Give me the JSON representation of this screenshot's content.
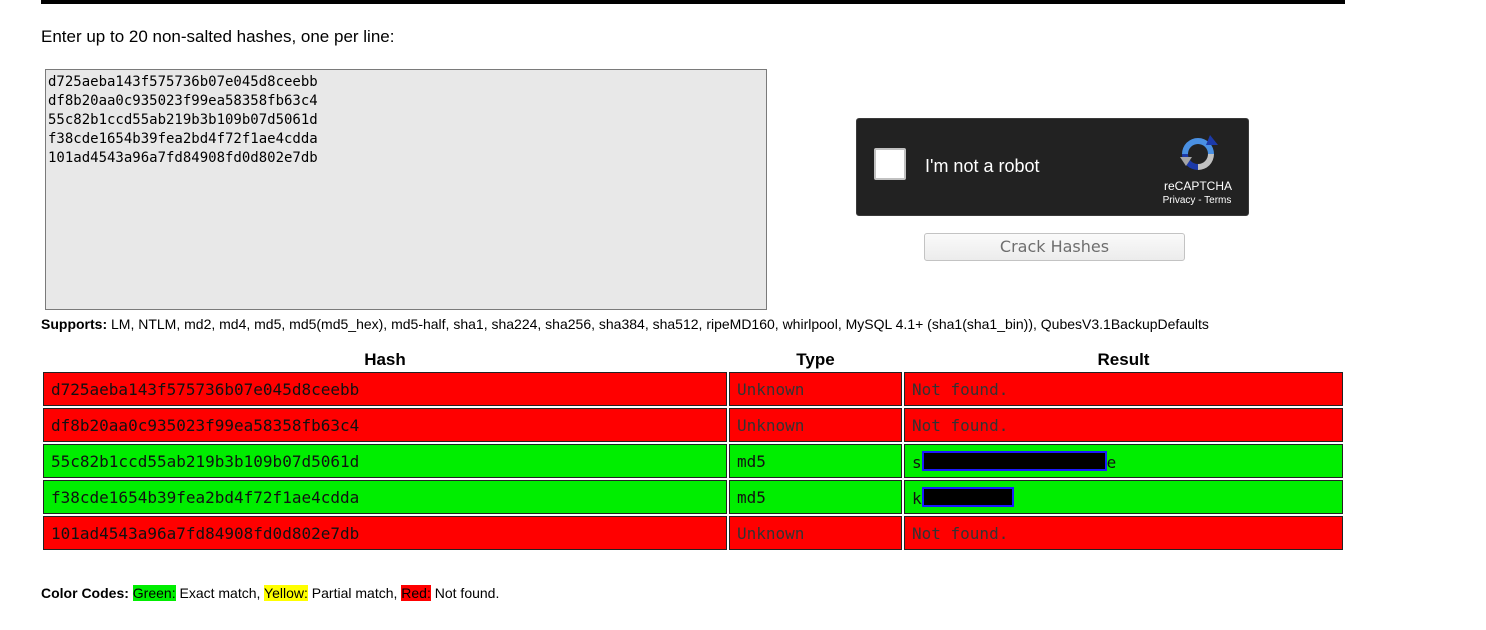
{
  "form": {
    "prompt": "Enter up to 20 non-salted hashes, one per line:",
    "hash_input_value": "d725aeba143f575736b07e045d8ceebb\ndf8b20aa0c935023f99ea58358fb63c4\n55c82b1ccd55ab219b3b109b07d5061d\nf38cde1654b39fea2bd4f72f1ae4cdda\n101ad4543a96a7fd84908fd0d802e7db",
    "crack_button_label": "Crack Hashes"
  },
  "recaptcha": {
    "checkbox_label": "I'm not a robot",
    "brand": "reCAPTCHA",
    "privacy_label": "Privacy",
    "separator": " - ",
    "terms_label": "Terms",
    "logo_icon": "recaptcha-logo-icon"
  },
  "supports": {
    "label": "Supports:",
    "text": " LM, NTLM, md2, md4, md5, md5(md5_hex), md5-half, sha1, sha224, sha256, sha384, sha512, ripeMD160, whirlpool, MySQL 4.1+ (sha1(sha1_bin)), QubesV3.1BackupDefaults"
  },
  "results_table": {
    "headers": {
      "hash": "Hash",
      "type": "Type",
      "result": "Result"
    },
    "rows": [
      {
        "hash": "d725aeba143f575736b07e045d8ceebb",
        "type": "Unknown",
        "result": "Not found.",
        "status": "red"
      },
      {
        "hash": "df8b20aa0c935023f99ea58358fb63c4",
        "type": "Unknown",
        "result": "Not found.",
        "status": "red"
      },
      {
        "hash": "55c82b1ccd55ab219b3b109b07d5061d",
        "type": "md5",
        "result_prefix": "s",
        "result_suffix": "e",
        "redacted": true,
        "status": "green"
      },
      {
        "hash": "f38cde1654b39fea2bd4f72f1ae4cdda",
        "type": "md5",
        "result_prefix": "k",
        "result_suffix": "",
        "redacted": true,
        "status": "green"
      },
      {
        "hash": "101ad4543a96a7fd84908fd0d802e7db",
        "type": "Unknown",
        "result": "Not found.",
        "status": "red"
      }
    ]
  },
  "legend": {
    "label": "Color Codes:",
    "green_label": "Green:",
    "green_desc": " Exact match, ",
    "yellow_label": "Yellow:",
    "yellow_desc": " Partial match, ",
    "red_label": "Red:",
    "red_desc": " Not found."
  },
  "colors": {
    "exact_match": "#00ee00",
    "partial_match": "#ffff00",
    "not_found": "#ff0000",
    "recaptcha_bg": "#222222",
    "redaction_border": "#1a1aff"
  }
}
